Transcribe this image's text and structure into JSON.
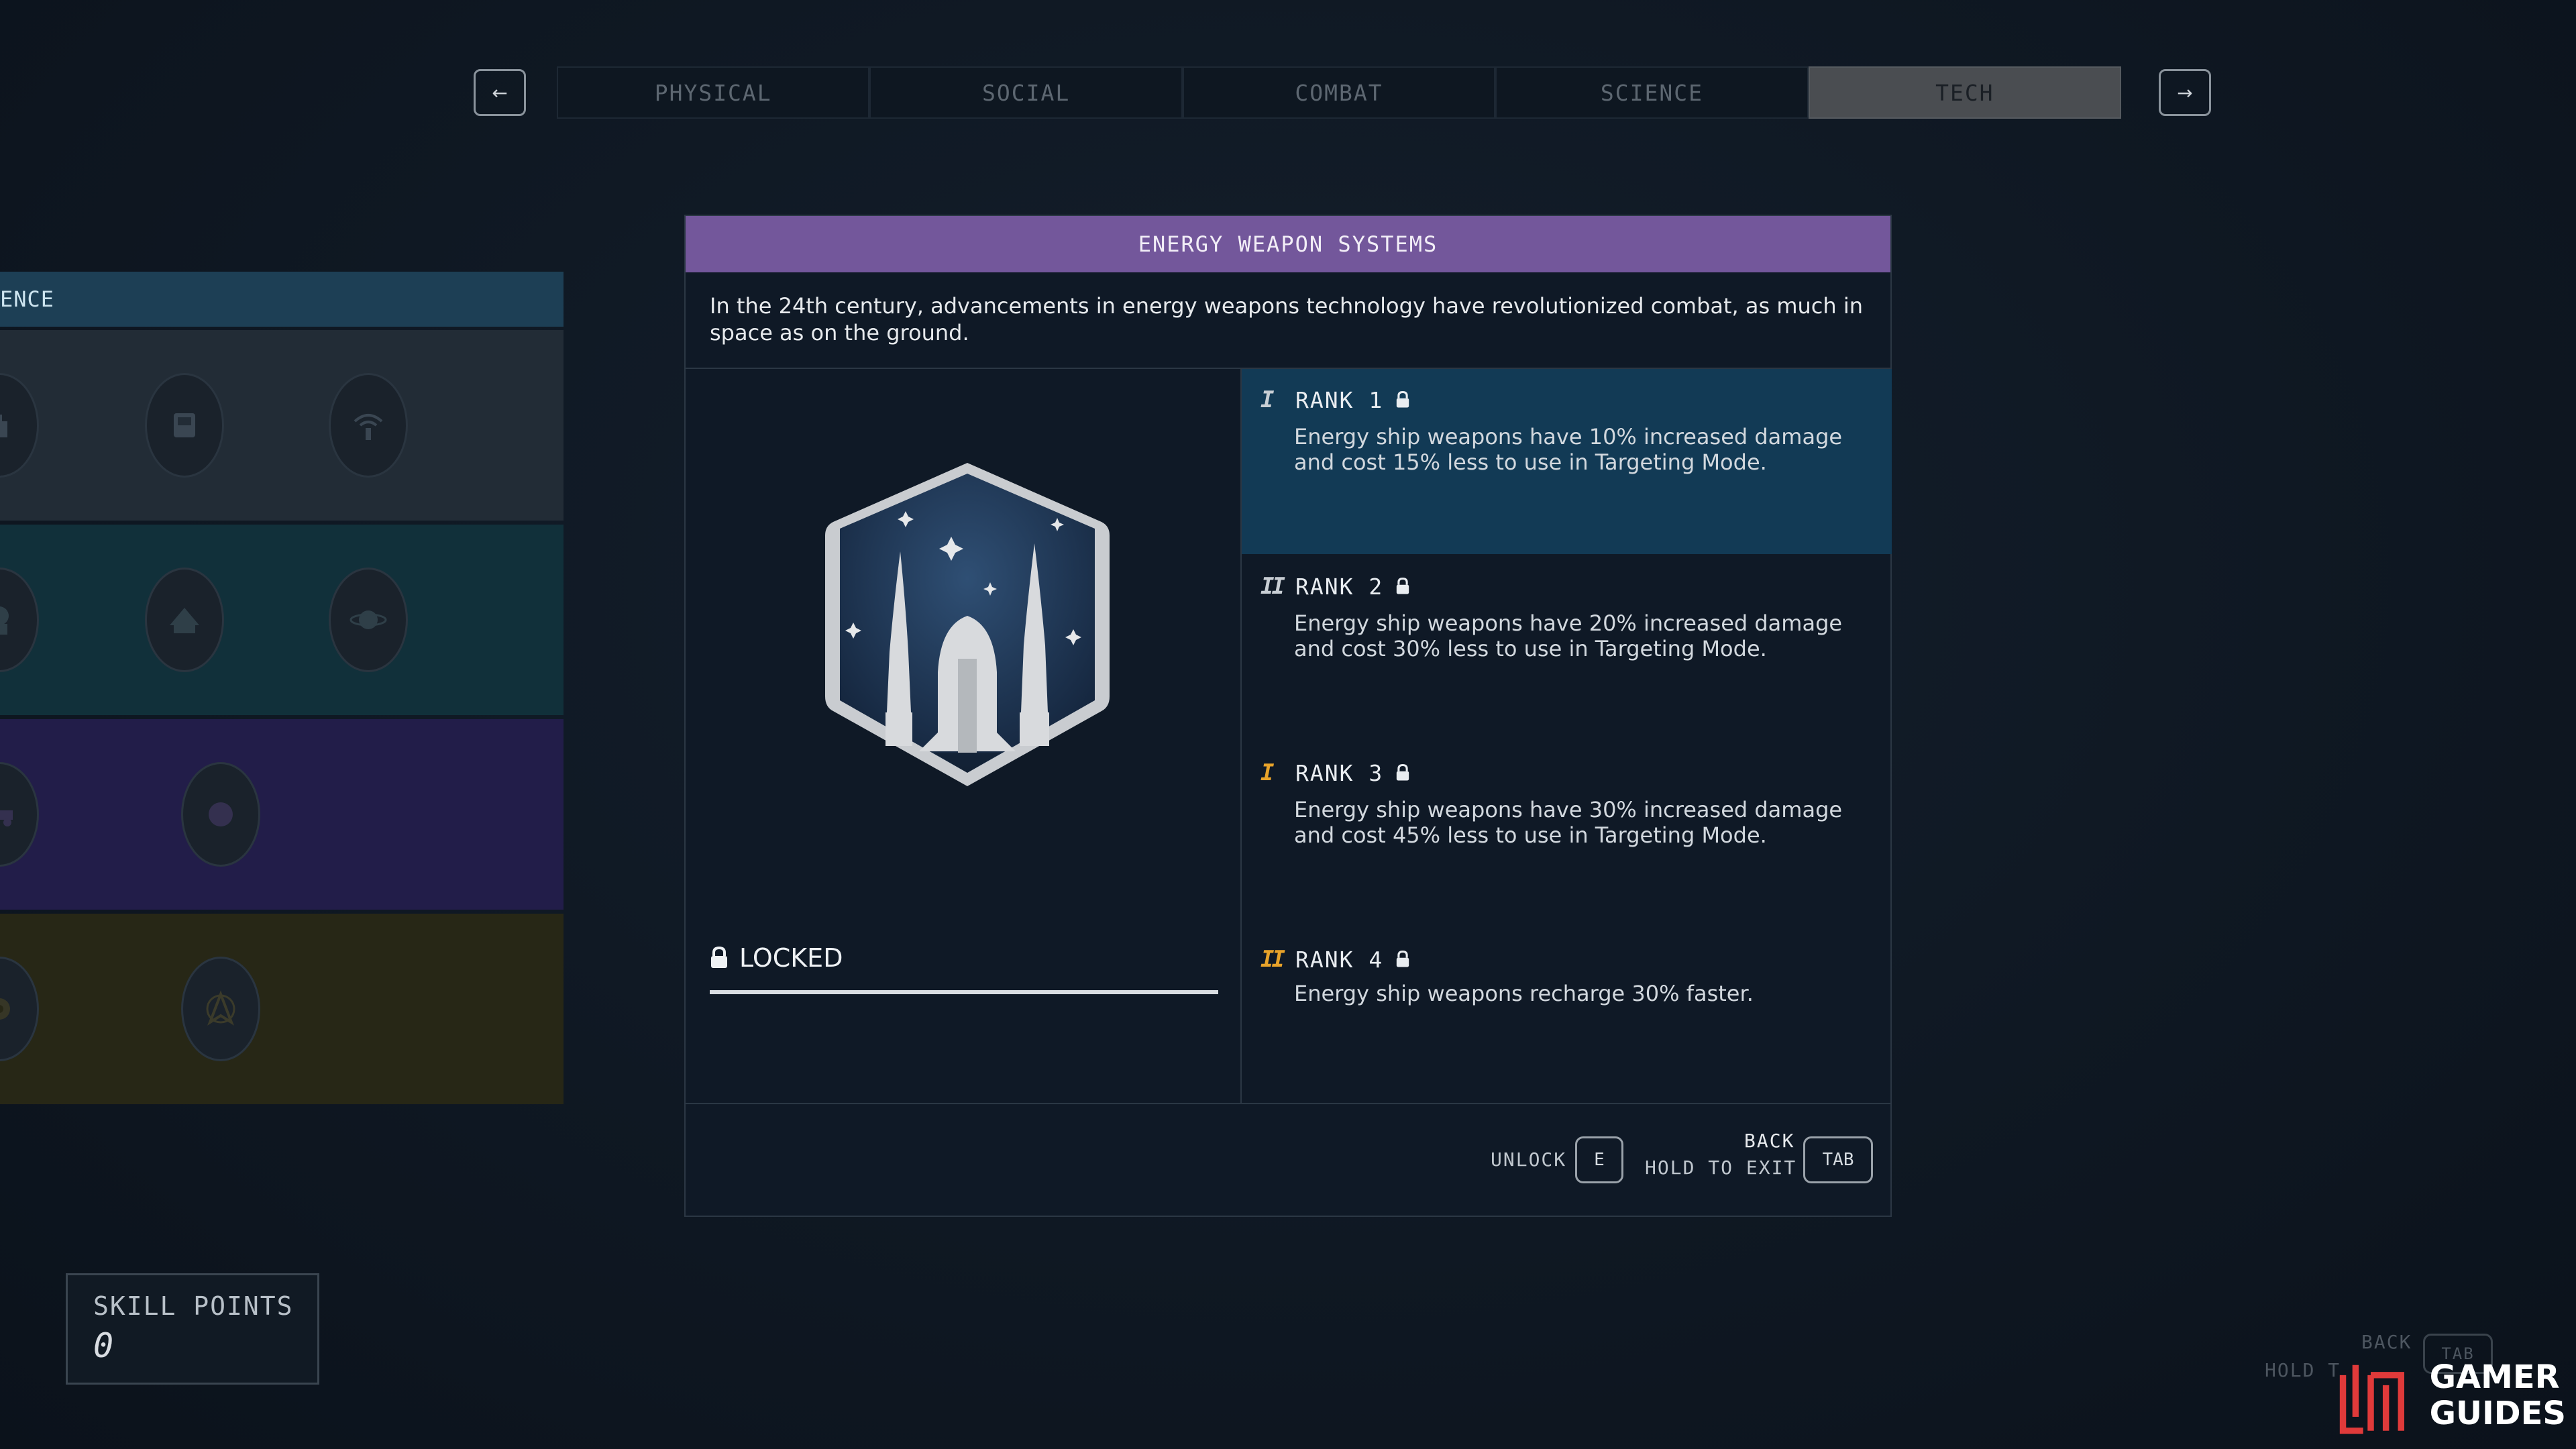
{
  "tabs": {
    "prev_icon": "arrow-left",
    "next_icon": "arrow-right",
    "items": [
      {
        "label": "PHYSICAL",
        "active": false
      },
      {
        "label": "SOCIAL",
        "active": false
      },
      {
        "label": "COMBAT",
        "active": false
      },
      {
        "label": "SCIENCE",
        "active": false
      },
      {
        "label": "TECH",
        "active": true
      }
    ]
  },
  "skill_tree": {
    "header_label": "ENCE",
    "row_colors": [
      "#222c36",
      "#11303a",
      "#221d49",
      "#272716"
    ]
  },
  "dialog": {
    "title": "ENERGY WEAPON SYSTEMS",
    "description": "In the 24th century, advancements in energy weapons technology have revolutionized combat, as much in space as on the ground.",
    "status": "LOCKED",
    "ranks": [
      {
        "label": "RANK 1",
        "marks": "I",
        "mark_color": "#c8ced4",
        "description": "Energy ship weapons have 10% increased damage and cost 15% less to use in Targeting Mode."
      },
      {
        "label": "RANK 2",
        "marks": "II",
        "mark_color": "#c8ced4",
        "description": "Energy ship weapons have 20% increased damage and cost 30% less to use in Targeting Mode."
      },
      {
        "label": "RANK 3",
        "marks": "I",
        "mark_color": "#e8a32a",
        "description": "Energy ship weapons have 30% increased damage and cost 45% less to use in Targeting Mode."
      },
      {
        "label": "RANK 4",
        "marks": "II",
        "mark_color": "#e8a32a",
        "description": "Energy ship weapons recharge 30% faster."
      }
    ],
    "footer": {
      "unlock_label": "UNLOCK",
      "unlock_key": "E",
      "back_label": "BACK",
      "hold_label": "HOLD TO EXIT",
      "back_key": "TAB"
    }
  },
  "skill_points": {
    "label": "SKILL POINTS",
    "value": "0"
  },
  "background_hints": {
    "back_label": "BACK",
    "hold_label": "HOLD T",
    "key_label": "TAB"
  },
  "watermark": {
    "line1": "GAMER",
    "line2": "GUIDES"
  }
}
